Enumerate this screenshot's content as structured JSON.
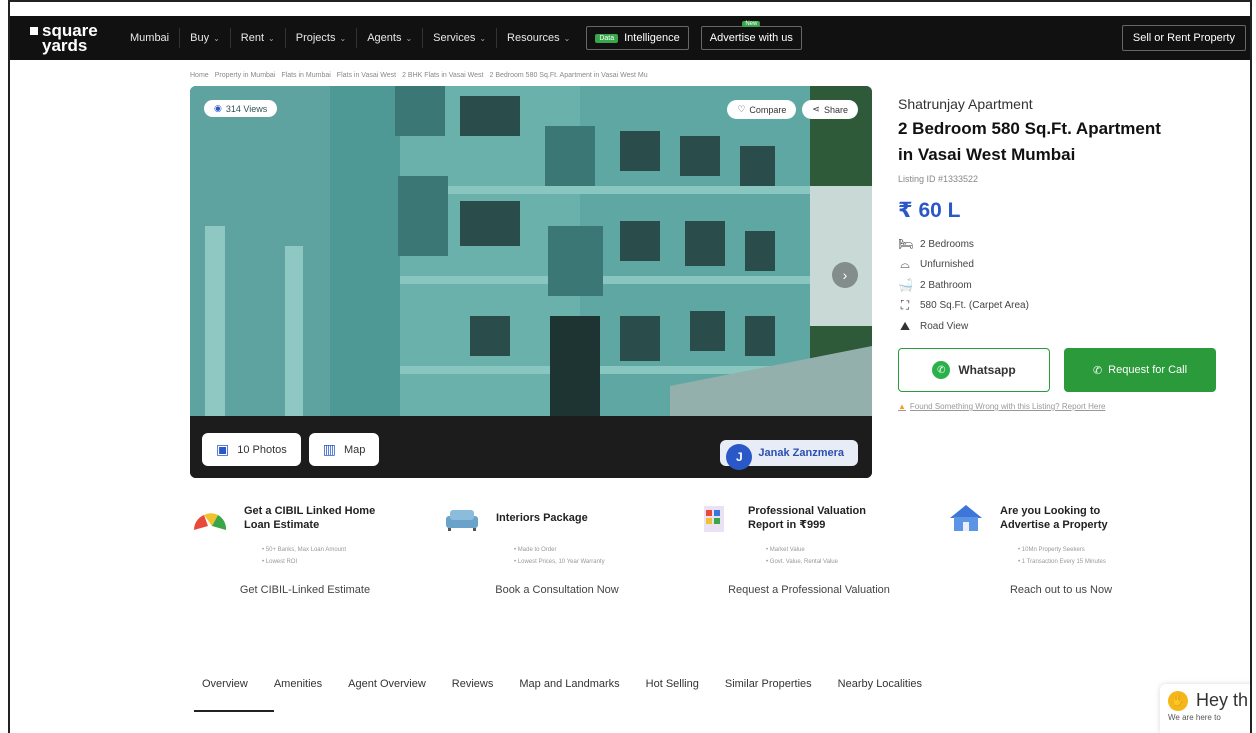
{
  "navbar": {
    "logo_line1": "square",
    "logo_line2": "yards",
    "city": "Mumbai",
    "menu": [
      "Buy",
      "Rent",
      "Projects",
      "Agents",
      "Services",
      "Resources"
    ],
    "data_badge": "Data",
    "intelligence": "Intelligence",
    "advertise": "Advertise with us",
    "new_tag": "New",
    "sell_rent": "Sell or Rent Property"
  },
  "breadcrumb": [
    "Home",
    "Property in Mumbai",
    "Flats in Mumbai",
    "Flats in Vasai West",
    "2 BHK Flats in Vasai West",
    "2 Bedroom 580 Sq.Ft. Apartment in Vasai West Mu"
  ],
  "hero": {
    "views": "314 Views",
    "compare": "Compare",
    "share": "Share",
    "photos": "10 Photos",
    "map": "Map",
    "agent_name": "Janak Zanzmera",
    "agent_initial": "J"
  },
  "listing": {
    "project": "Shatrunjay Apartment",
    "title_line1": "2 Bedroom 580 Sq.Ft. Apartment",
    "title_line2": "in Vasai West Mumbai",
    "listing_id": "Listing ID #1333522",
    "price": "₹ 60 L",
    "specs": [
      "2 Bedrooms",
      "Unfurnished",
      "2 Bathroom",
      "580 Sq.Ft. (Carpet Area)",
      "Road View"
    ],
    "whatsapp": "Whatsapp",
    "request_call": "Request for Call",
    "report": "Found Something Wrong with this Listing? Report Here"
  },
  "services": [
    {
      "title_line1": "Get a CIBIL Linked Home",
      "title_line2": "Loan Estimate",
      "bullets": [
        "50+ Banks, Max Loan Amount",
        "Lowest ROI"
      ],
      "link": "Get CIBIL-Linked Estimate"
    },
    {
      "title_line1": "Interiors Package",
      "title_line2": "",
      "bullets": [
        "Made to Order",
        "Lowest Prices, 10 Year Warranty"
      ],
      "link": "Book a Consultation Now"
    },
    {
      "title_line1": "Professional Valuation",
      "title_line2": "Report in ₹999",
      "bullets": [
        "Market Value",
        "Govt. Value, Rental Value"
      ],
      "link": "Request a Professional Valuation"
    },
    {
      "title_line1": "Are you Looking to",
      "title_line2": "Advertise a Property",
      "bullets": [
        "10Mn Property Seekers",
        "1 Transaction Every 15 Minutes"
      ],
      "link": "Reach out to us Now"
    }
  ],
  "tabs": [
    "Overview",
    "Amenities",
    "Agent Overview",
    "Reviews",
    "Map and Landmarks",
    "Hot Selling",
    "Similar Properties",
    "Nearby Localities"
  ],
  "chat": {
    "title": "Hey th",
    "subtitle": "We are here to"
  },
  "colors": {
    "brand_blue": "#2a58c8",
    "green": "#2b9a3b",
    "nav_bg": "#111111"
  }
}
